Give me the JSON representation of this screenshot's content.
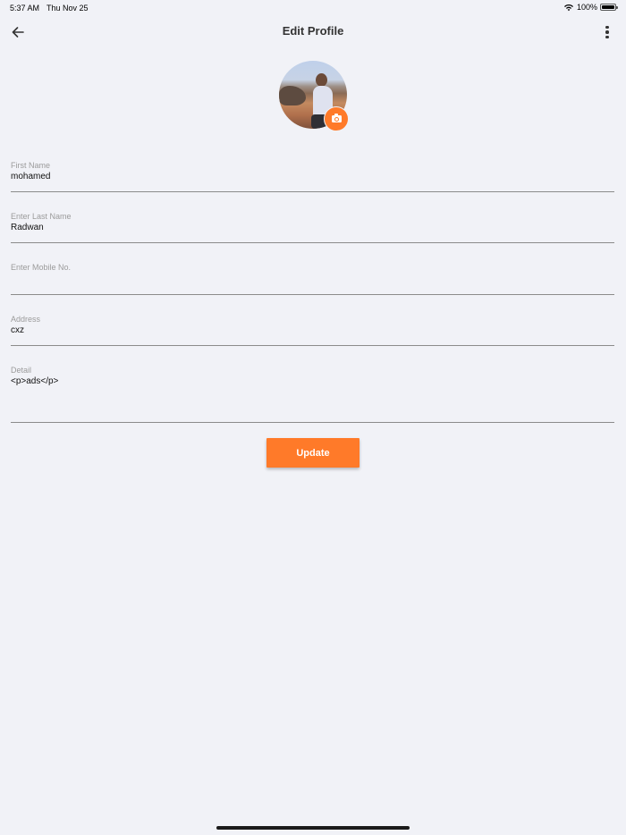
{
  "status_bar": {
    "time": "5:37 AM",
    "date": "Thu Nov 25",
    "battery": "100%",
    "battery_level": 1.0
  },
  "header": {
    "title": "Edit Profile",
    "back_icon": "arrow-left-icon",
    "more_icon": "more-vertical-icon"
  },
  "avatar": {
    "camera_icon": "camera-icon"
  },
  "form": {
    "first_name": {
      "label": "First Name",
      "value": "mohamed"
    },
    "last_name": {
      "label": "Enter Last Name",
      "value": "Radwan"
    },
    "mobile": {
      "label": "Enter Mobile No.",
      "value": ""
    },
    "address": {
      "label": "Address",
      "value": "cxz"
    },
    "detail": {
      "label": "Detail",
      "value": "<p>ads</p>"
    }
  },
  "actions": {
    "update_label": "Update"
  },
  "colors": {
    "accent": "#ff7a29",
    "background": "#f1f2f7"
  }
}
